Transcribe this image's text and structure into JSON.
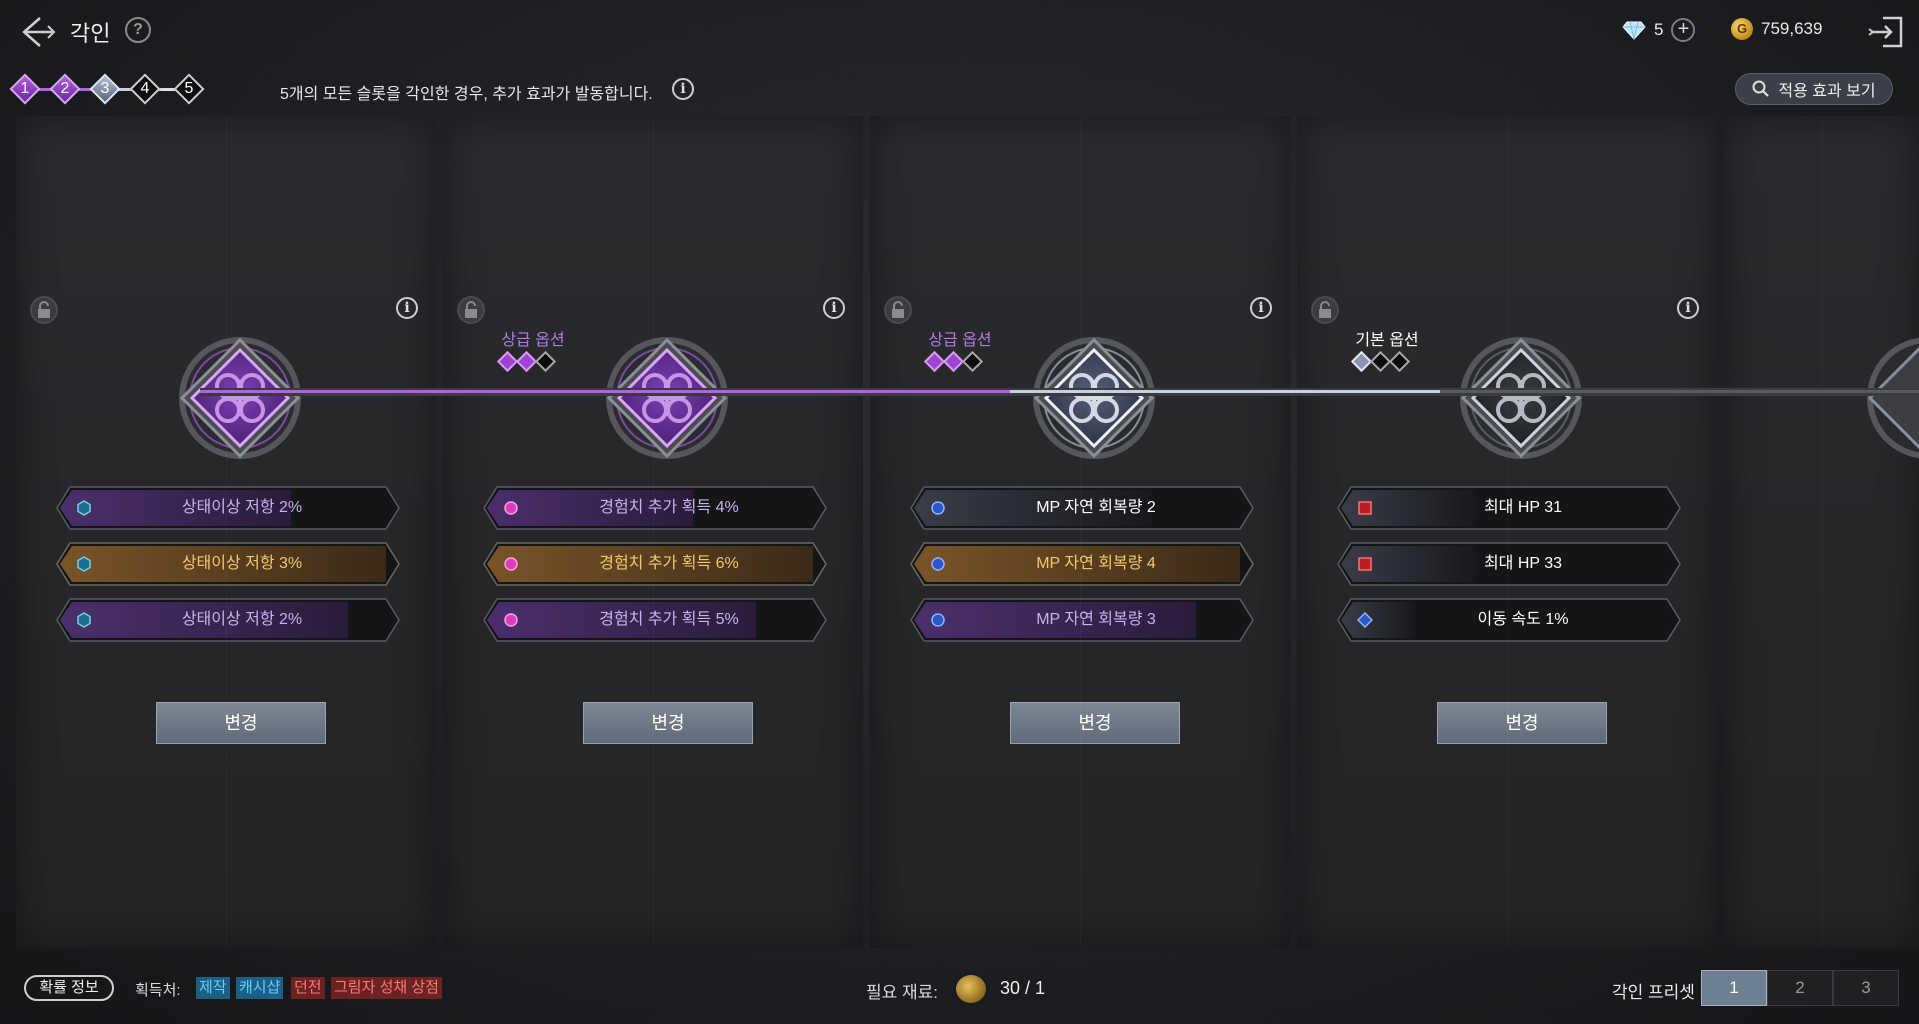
{
  "header": {
    "title": "각인",
    "diamonds": "5",
    "gold": "759,639",
    "gold_symbol": "G"
  },
  "steps": {
    "items": [
      {
        "label": "1",
        "state": "purple"
      },
      {
        "label": "2",
        "state": "purple"
      },
      {
        "label": "3",
        "state": "silver"
      },
      {
        "label": "4",
        "state": "dark"
      },
      {
        "label": "5",
        "state": "dark"
      }
    ],
    "message": "5개의 모든 슬롯을 각인한 경우, 추가 효과가 발동합니다."
  },
  "view_effect_label": "적용 효과 보기",
  "slots": [
    {
      "grade_label": "",
      "grade_color": "#b07be6",
      "tier": "purple",
      "gems": [],
      "change_label": "변경",
      "options": [
        {
          "text": "상태이상 저항 2%",
          "style": "purple",
          "icon": "hexagon-icon",
          "fill": 0.7
        },
        {
          "text": "상태이상 저항 3%",
          "style": "gold",
          "icon": "hexagon-icon",
          "fill": 1.0
        },
        {
          "text": "상태이상 저항 2%",
          "style": "purple",
          "icon": "hexagon-icon",
          "fill": 0.88
        }
      ]
    },
    {
      "grade_label": "상급 옵션",
      "grade_color": "#b07be6",
      "tier": "purple",
      "gems": [
        "purple",
        "purple",
        "dark"
      ],
      "change_label": "변경",
      "options": [
        {
          "text": "경험치 추가 획득 4%",
          "style": "purple",
          "icon": "circle-icon",
          "fill": 0.62
        },
        {
          "text": "경험치 추가 획득 6%",
          "style": "gold",
          "icon": "circle-icon",
          "fill": 1.0
        },
        {
          "text": "경험치 추가 획득 5%",
          "style": "purple",
          "icon": "circle-icon",
          "fill": 0.82
        }
      ]
    },
    {
      "grade_label": "상급 옵션",
      "grade_color": "#b07be6",
      "tier": "silver",
      "gems": [
        "purple",
        "purple",
        "dark"
      ],
      "change_label": "변경",
      "options": [
        {
          "text": "MP 자연 회복량 2",
          "style": "silver",
          "icon": "circle-blue-icon",
          "fill": 0.72
        },
        {
          "text": "MP 자연 회복량 4",
          "style": "gold",
          "icon": "circle-blue-icon",
          "fill": 1.0
        },
        {
          "text": "MP 자연 회복량 3",
          "style": "purple",
          "icon": "circle-blue-icon",
          "fill": 0.86
        }
      ]
    },
    {
      "grade_label": "기본 옵션",
      "grade_color": "#ffffff",
      "tier": "dark",
      "gems": [
        "silver",
        "dark",
        "dark"
      ],
      "change_label": "변경",
      "options": [
        {
          "text": "최대 HP 31",
          "style": "silver",
          "icon": "red-square-icon",
          "fill": 0.4
        },
        {
          "text": "최대 HP 33",
          "style": "silver",
          "icon": "red-square-icon",
          "fill": 0.4
        },
        {
          "text": "이동 속도 1%",
          "style": "silver",
          "icon": "blue-diamond-icon",
          "fill": 0.2
        }
      ]
    }
  ],
  "footer": {
    "prob_info_label": "확률 정보",
    "source_label": "획득처:",
    "sources": [
      {
        "text": "제작",
        "color": "blue"
      },
      {
        "text": "캐시샵",
        "color": "blue"
      },
      {
        "text": "던전",
        "color": "red"
      },
      {
        "text": "그림자 성채 상점",
        "color": "red"
      }
    ],
    "material_label": "필요 재료:",
    "material_count": "30 / 1",
    "preset_label": "각인 프리셋",
    "presets": [
      "1",
      "2",
      "3"
    ],
    "active_preset": 0
  },
  "colors": {
    "purple": "#a04ad8",
    "gold": "#e0b04a",
    "silver": "#c9cfe0",
    "blue_tag": "#5fd0ff",
    "red_tag": "#ff7a72"
  }
}
